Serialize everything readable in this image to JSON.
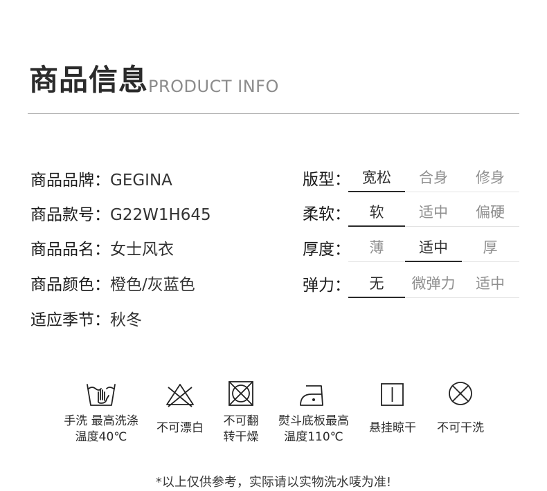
{
  "header": {
    "title_zh": "商品信息",
    "title_en": "PRODUCT INFO"
  },
  "info": [
    {
      "label": "商品品牌：",
      "value": "GEGINA"
    },
    {
      "label": "商品款号：",
      "value": "G22W1H645"
    },
    {
      "label": "商品品名：",
      "value": "女士风衣"
    },
    {
      "label": "商品颜色：",
      "value": "橙色/灰蓝色"
    },
    {
      "label": "适应季节：",
      "value": "秋冬"
    }
  ],
  "attributes": [
    {
      "label": "版型：",
      "options": [
        "宽松",
        "合身",
        "修身"
      ],
      "selected": "宽松"
    },
    {
      "label": "柔软：",
      "options": [
        "软",
        "适中",
        "偏硬"
      ],
      "selected": "软"
    },
    {
      "label": "厚度：",
      "options": [
        "薄",
        "适中",
        "厚"
      ],
      "selected": "适中"
    },
    {
      "label": "弹力：",
      "options": [
        "无",
        "微弹力",
        "适中"
      ],
      "selected": "无"
    }
  ],
  "care": [
    {
      "icon": "hand-wash-icon",
      "line1": "手洗 最高洗涤",
      "line2": "温度40℃"
    },
    {
      "icon": "no-bleach-icon",
      "line1": "不可漂白",
      "line2": ""
    },
    {
      "icon": "no-tumble-dry-icon",
      "line1": "不可翻",
      "line2": "转干燥"
    },
    {
      "icon": "iron-icon",
      "line1": "熨斗底板最高",
      "line2": "温度110℃"
    },
    {
      "icon": "line-dry-icon",
      "line1": "悬挂晾干",
      "line2": ""
    },
    {
      "icon": "no-dry-clean-icon",
      "line1": "不可干洗",
      "line2": ""
    }
  ],
  "note": "*以上仅供参考，实际请以实物洗水唛为准!"
}
